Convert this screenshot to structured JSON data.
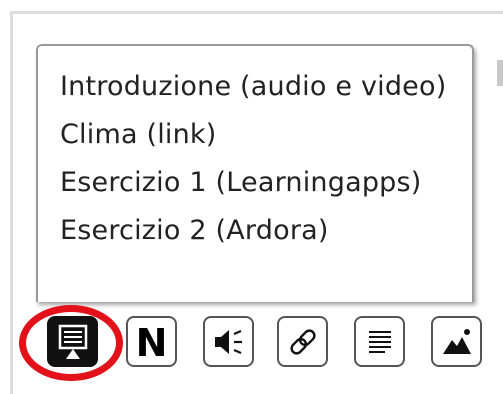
{
  "menu": {
    "items": [
      {
        "label": "Introduzione (audio e video)"
      },
      {
        "label": "Clima (link)"
      },
      {
        "label": "Esercizio 1 (Learningapps)"
      },
      {
        "label": "Esercizio 2 (Ardora)"
      }
    ]
  },
  "toolbar": {
    "buttons": [
      {
        "name": "presentation-icon",
        "active": true
      },
      {
        "name": "notes-n-icon",
        "glyph": "N",
        "active": false
      },
      {
        "name": "speaker-icon",
        "active": false
      },
      {
        "name": "link-icon",
        "active": false
      },
      {
        "name": "text-lines-icon",
        "active": false
      },
      {
        "name": "image-mountain-icon",
        "active": false
      }
    ]
  },
  "colors": {
    "highlight": "#e2111a",
    "active_button": "#111111",
    "button_border": "#555555"
  }
}
